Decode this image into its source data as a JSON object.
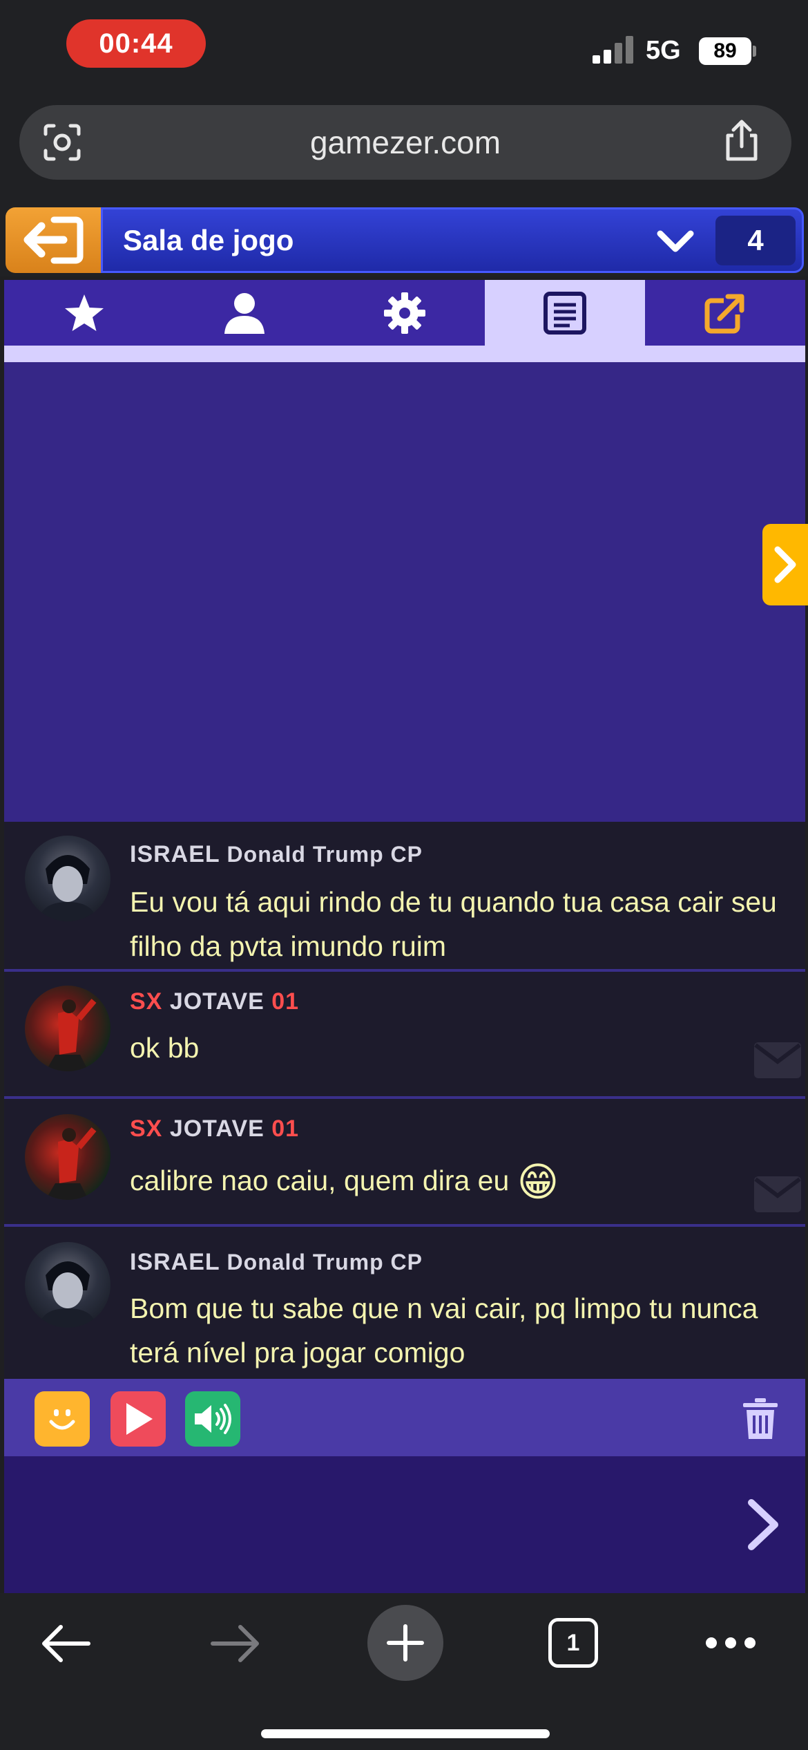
{
  "status_bar": {
    "time": "00:44",
    "network": "5G",
    "battery": "89"
  },
  "browser": {
    "url": "gamezer.com",
    "open_tabs": "1"
  },
  "header": {
    "title": "Sala de jogo",
    "count": "4"
  },
  "tabs": [
    {
      "icon": "star-icon",
      "active": false
    },
    {
      "icon": "user-icon",
      "active": false
    },
    {
      "icon": "gear-icon",
      "active": false
    },
    {
      "icon": "document-icon",
      "active": true
    },
    {
      "icon": "popout-icon",
      "active": false
    }
  ],
  "messages": [
    {
      "user_prefix": "ISRAEL",
      "user_main": "Donald Trump CP",
      "user_suffix": "",
      "text": "Eu vou tá aqui rindo de tu quando tua casa cair seu filho da pvta imundo ruim",
      "emoji": ""
    },
    {
      "user_prefix": "SX",
      "user_main": "JOTAVE",
      "user_suffix": "01",
      "text": "ok bb",
      "emoji": ""
    },
    {
      "user_prefix": "SX",
      "user_main": "JOTAVE",
      "user_suffix": "01",
      "text": "calibre nao caiu, quem dira eu",
      "emoji": "😁"
    },
    {
      "user_prefix": "ISRAEL",
      "user_main": "Donald Trump CP",
      "user_suffix": "",
      "text": "Bom que tu sabe que n vai cair, pq limpo tu nunca terá nível pra jogar comigo",
      "emoji": ""
    }
  ],
  "chat_input": {
    "value": "",
    "placeholder": ""
  },
  "colors": {
    "accent_orange": "#f2a235",
    "title_blue": "#2a35c4",
    "tab_purple": "#3c28a3",
    "game_bg": "#362787",
    "message_text": "#f4f4b0",
    "username_red": "#ff4e4e"
  }
}
